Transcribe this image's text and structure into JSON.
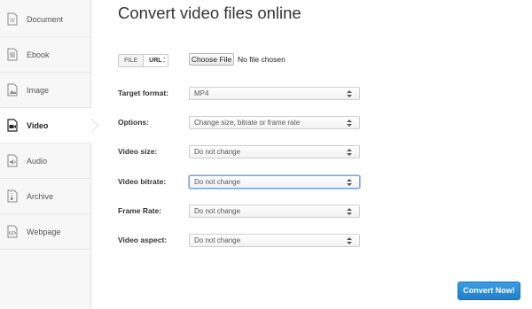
{
  "sidebar": {
    "items": [
      {
        "label": "Document",
        "icon": "document-icon"
      },
      {
        "label": "Ebook",
        "icon": "ebook-icon"
      },
      {
        "label": "Image",
        "icon": "image-icon"
      },
      {
        "label": "Video",
        "icon": "video-icon",
        "active": true
      },
      {
        "label": "Audio",
        "icon": "audio-icon"
      },
      {
        "label": "Archive",
        "icon": "archive-icon"
      },
      {
        "label": "Webpage",
        "icon": "webpage-icon"
      }
    ]
  },
  "main": {
    "title": "Convert video files online",
    "source_tabs": {
      "file": "FILE",
      "url": "URL",
      "active": "URL"
    },
    "colon": ":",
    "choose_file_label": "Choose File",
    "file_status": "No file chosen",
    "fields": [
      {
        "label": "Target format:",
        "value": "MP4"
      },
      {
        "label": "Options:",
        "value": "Change size, bitrate or frame rate"
      },
      {
        "label": "Video size:",
        "value": "Do not change"
      },
      {
        "label": "Video bitrate:",
        "value": "Do not change",
        "focused": true
      },
      {
        "label": "Frame Rate:",
        "value": "Do not change"
      },
      {
        "label": "Video aspect:",
        "value": "Do not change"
      }
    ],
    "convert_button": "Convert Now!"
  },
  "colors": {
    "accent": "#1d7fcf",
    "sidebar_bg": "#f7f7f7",
    "focus": "#7aa7d8"
  }
}
